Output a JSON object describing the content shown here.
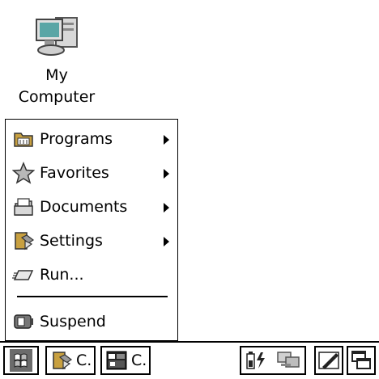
{
  "desktop": {
    "icons": [
      {
        "label_line1": "My",
        "label_line2": "Computer",
        "icon": "my-computer-icon"
      }
    ]
  },
  "start_menu": {
    "items": [
      {
        "label": "Programs",
        "icon": "programs-folder-icon",
        "has_submenu": true
      },
      {
        "label": "Favorites",
        "icon": "favorites-star-icon",
        "has_submenu": true
      },
      {
        "label": "Documents",
        "icon": "documents-icon",
        "has_submenu": true
      },
      {
        "label": "Settings",
        "icon": "settings-icon",
        "has_submenu": true
      },
      {
        "label": "Run...",
        "icon": "run-icon",
        "has_submenu": false
      },
      {
        "label": "Suspend",
        "icon": "suspend-icon",
        "has_submenu": false
      }
    ]
  },
  "taskbar": {
    "start_button": {
      "icon": "start-flag-icon"
    },
    "tasks": [
      {
        "label": "C.",
        "icon": "control-panel-icon"
      },
      {
        "label": "C.",
        "icon": "command-prompt-icon"
      }
    ],
    "tray": {
      "icons": [
        "battery-power-icon",
        "network-icon"
      ]
    },
    "input_panel": {
      "icon": "input-panel-pen-icon"
    },
    "desktop_switch": {
      "icon": "switch-windows-icon"
    }
  },
  "colors": {
    "background": "#ffffff",
    "foreground": "#000000",
    "folder_yellow": "#c8a040",
    "monitor_teal": "#5aa6a6",
    "star_gray": "#b8b8b8"
  }
}
